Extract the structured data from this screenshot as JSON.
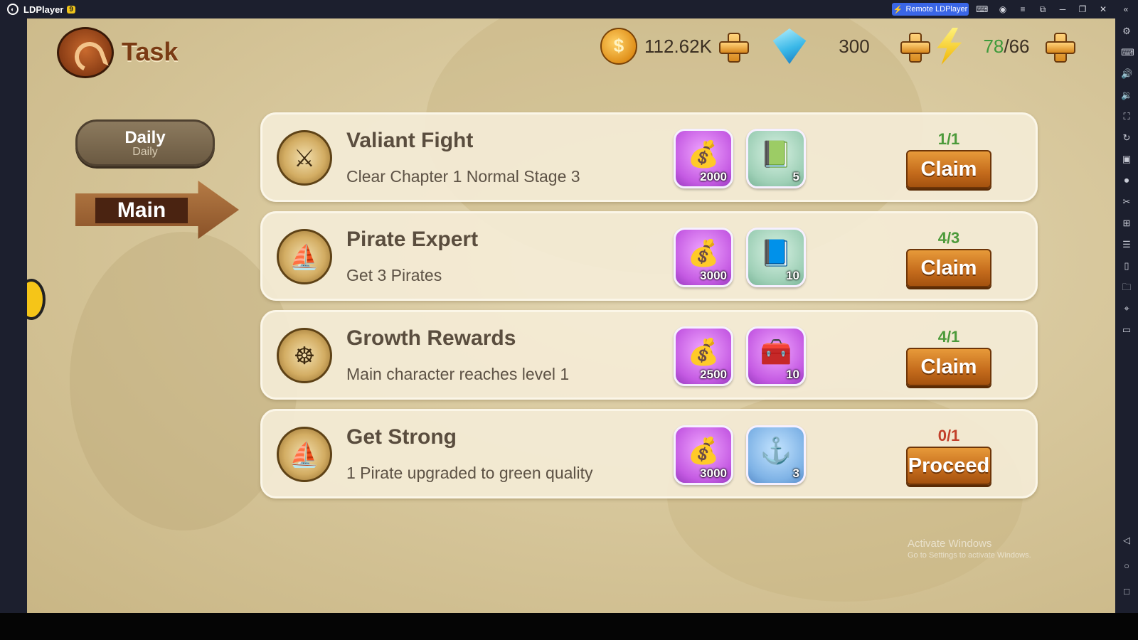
{
  "window": {
    "app_name": "LDPlayer",
    "badge": "9",
    "remote_label": "Remote LDPlayer"
  },
  "header": {
    "title": "Task",
    "currencies": [
      {
        "icon": "coin-icon",
        "value": "112.62K"
      },
      {
        "icon": "gem-icon",
        "value": "300"
      },
      {
        "icon": "energy-bolt-icon",
        "value_current": "78",
        "value_max": "/66"
      }
    ]
  },
  "tabs": {
    "daily": {
      "label": "Daily",
      "sublabel": "Daily"
    },
    "main": {
      "label": "Main"
    }
  },
  "tasks": [
    {
      "title": "Valiant Fight",
      "desc": "Clear Chapter 1 Normal Stage 3",
      "emblem": "crossed-swords-icon",
      "rewards": [
        {
          "icon": "money-bag-icon",
          "count": "2000"
        },
        {
          "icon": "exp-book-icon",
          "count": "5"
        }
      ],
      "progress": "1/1",
      "action": "Claim"
    },
    {
      "title": "Pirate Expert",
      "desc": "Get 3 Pirates",
      "emblem": "ship-icon",
      "rewards": [
        {
          "icon": "money-bag-icon",
          "count": "3000"
        },
        {
          "icon": "exp-book-icon",
          "count": "10"
        }
      ],
      "progress": "4/3",
      "action": "Claim"
    },
    {
      "title": "Growth Rewards",
      "desc": "Main character reaches level 1",
      "emblem": "ship-wheel-icon",
      "rewards": [
        {
          "icon": "money-bag-icon",
          "count": "2500"
        },
        {
          "icon": "treasure-chest-icon",
          "count": "10"
        }
      ],
      "progress": "4/1",
      "action": "Claim"
    },
    {
      "title": "Get Strong",
      "desc": "1 Pirate upgraded to green quality",
      "emblem": "ship-icon",
      "rewards": [
        {
          "icon": "money-bag-icon",
          "count": "3000"
        },
        {
          "icon": "anchor-emblem-icon",
          "count": "3"
        }
      ],
      "progress": "0/1",
      "action": "Proceed"
    }
  ],
  "watermark": {
    "line1": "Activate Windows",
    "line2": "Go to Settings to activate Windows."
  }
}
